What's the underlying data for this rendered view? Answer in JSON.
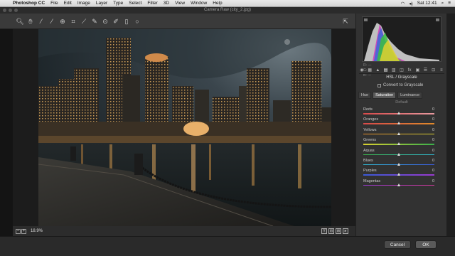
{
  "menubar": {
    "apple": "",
    "app": "Photoshop CC",
    "items": [
      "File",
      "Edit",
      "Image",
      "Layer",
      "Type",
      "Select",
      "Filter",
      "3D",
      "View",
      "Window",
      "Help"
    ],
    "clock": "Sat 12:41"
  },
  "window": {
    "title": "Camera Raw (city_2.jpg)"
  },
  "tools": [
    "zoom-tool",
    "hand-tool",
    "white-balance-tool",
    "color-sampler-tool",
    "targeted-adjustment-tool",
    "crop-tool",
    "straighten-tool",
    "spot-removal-tool",
    "red-eye-tool",
    "adjustment-brush-tool",
    "graduated-filter-tool",
    "radial-filter-tool"
  ],
  "bottom": {
    "zoom_minus": "−",
    "zoom_plus": "+",
    "zoom": "18.9%",
    "view_labels": [
      "Y",
      "⊟",
      "⊞",
      "▸"
    ]
  },
  "panel": {
    "rgb": [
      "R:  ---",
      "G:  ---",
      "B:  ---"
    ],
    "title": "HSL / Grayscale",
    "grayscale_label": "Convert to Grayscale",
    "subtabs": [
      "Hue",
      "Saturation",
      "Luminance"
    ],
    "active_subtab": 1,
    "default_label": "Default",
    "sliders": [
      {
        "label": "Reds",
        "value": "0",
        "c1": "#d84a4a",
        "c2": "#e89aa0"
      },
      {
        "label": "Oranges",
        "value": "0",
        "c1": "#d84a4a",
        "c2": "#e08a2a"
      },
      {
        "label": "Yellows",
        "value": "0",
        "c1": "#e08a2a",
        "c2": "#d8d030"
      },
      {
        "label": "Greens",
        "value": "0",
        "c1": "#d8d030",
        "c2": "#3ab04a"
      },
      {
        "label": "Aquas",
        "value": "0",
        "c1": "#3ab04a",
        "c2": "#30b0c8"
      },
      {
        "label": "Blues",
        "value": "0",
        "c1": "#30b0c8",
        "c2": "#3a5ad8"
      },
      {
        "label": "Purples",
        "value": "0",
        "c1": "#3a5ad8",
        "c2": "#9a3ad0"
      },
      {
        "label": "Magentas",
        "value": "0",
        "c1": "#9a3ad0",
        "c2": "#d03a9a"
      }
    ]
  },
  "footer": {
    "cancel": "Cancel",
    "ok": "OK"
  },
  "colors": {
    "accent": "#3a7bd5",
    "panel_bg": "#323232"
  }
}
